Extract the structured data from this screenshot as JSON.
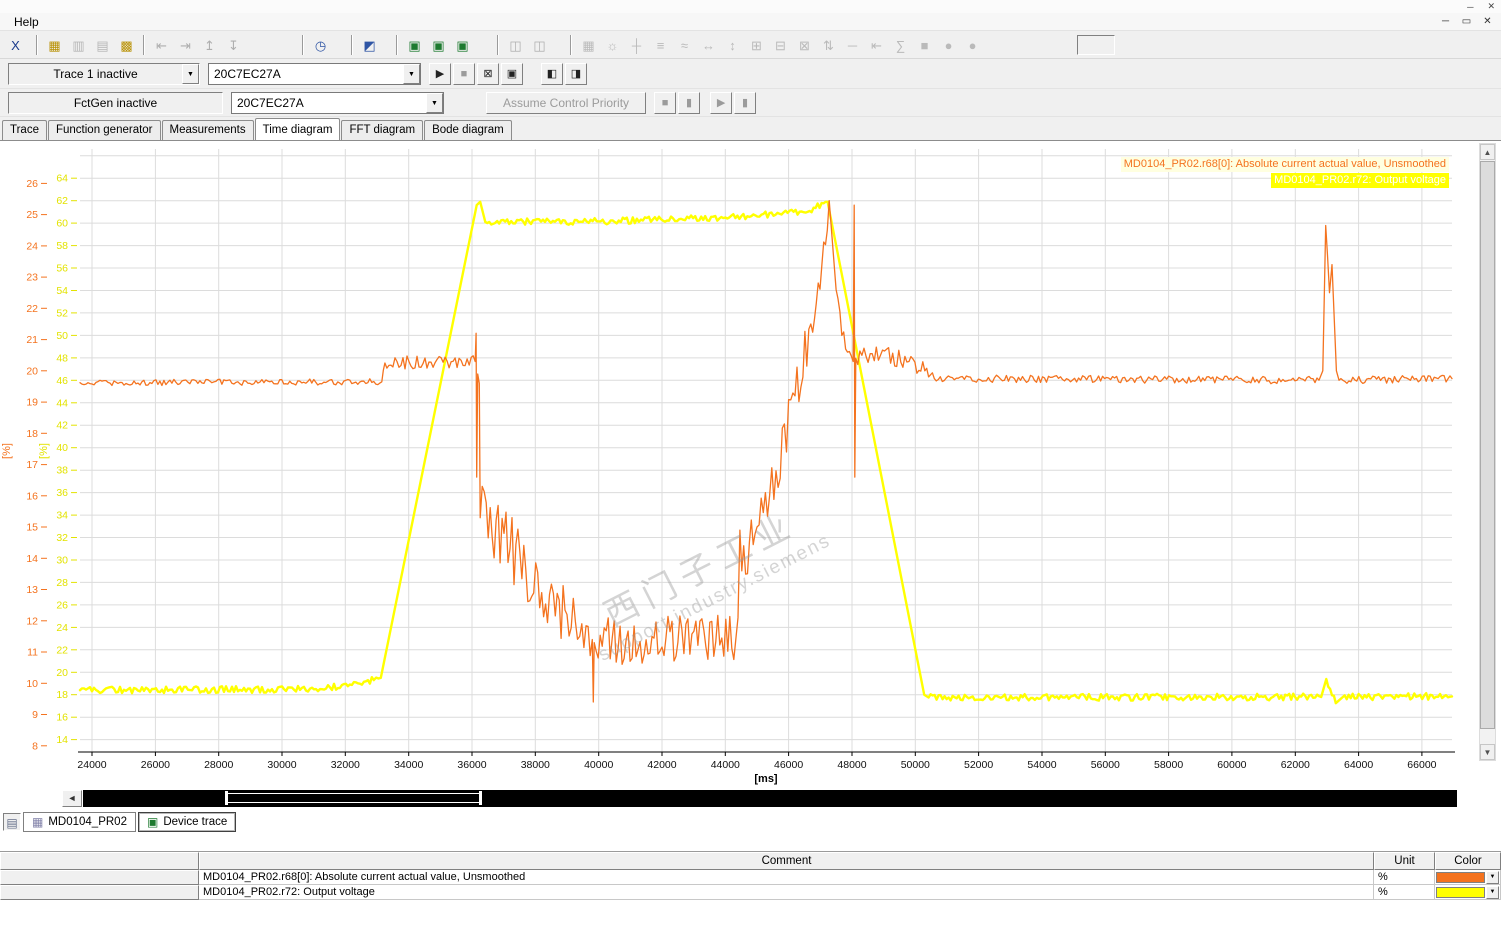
{
  "window": {
    "menu_help": "Help"
  },
  "toolbar": {
    "groups": [
      {
        "icons": [
          {
            "n": "trace-export-icon",
            "g": "X",
            "c": "#1a3a8c",
            "e": true
          }
        ]
      },
      {
        "icons": [
          {
            "n": "show-signal-table-icon",
            "g": "▦",
            "c": "#b89000",
            "e": true
          },
          {
            "n": "copy-diagram-icon",
            "g": "▥",
            "c": "#666666",
            "e": false
          },
          {
            "n": "print-diagram-icon",
            "g": "▤",
            "c": "#666666",
            "e": false
          },
          {
            "n": "signal-grid-icon",
            "g": "▩",
            "c": "#b89000",
            "e": true
          }
        ]
      },
      {
        "icons": [
          {
            "n": "pan-left-icon",
            "g": "⇤",
            "c": "#555555",
            "e": false
          },
          {
            "n": "pan-right-icon",
            "g": "⇥",
            "c": "#555555",
            "e": false
          },
          {
            "n": "dock-up-icon",
            "g": "↥",
            "c": "#555555",
            "e": false
          },
          {
            "n": "dock-down-icon",
            "g": "↧",
            "c": "#555555",
            "e": false
          }
        ]
      },
      {
        "icons": [
          {
            "n": "measurement-clock-icon",
            "g": "◷",
            "c": "#2f55a4",
            "e": true
          }
        ]
      },
      {
        "icons": [
          {
            "n": "control-panel-icon",
            "g": "◩",
            "c": "#2f55a4",
            "e": true
          }
        ]
      },
      {
        "icons": [
          {
            "n": "trace-screen-1-icon",
            "g": "▣",
            "c": "#1d7a2f",
            "e": true
          },
          {
            "n": "trace-screen-2-icon",
            "g": "▣",
            "c": "#1d7a2f",
            "e": true
          },
          {
            "n": "trace-screen-3-icon",
            "g": "▣",
            "c": "#1d7a2f",
            "e": true
          }
        ]
      },
      {
        "icons": [
          {
            "n": "new-window-icon",
            "g": "◫",
            "c": "#555555",
            "e": false
          },
          {
            "n": "split-window-icon",
            "g": "◫",
            "c": "#555555",
            "e": false
          }
        ]
      },
      {
        "icons": [
          {
            "n": "grid-toggle-icon",
            "g": "▦",
            "c": "#707070",
            "e": false
          },
          {
            "n": "settings-icon",
            "g": "☼",
            "c": "#707070",
            "e": false
          },
          {
            "n": "crosshair-cursor-icon",
            "g": "┼",
            "c": "#707070",
            "e": false
          },
          {
            "n": "align-curves-icon",
            "g": "≡",
            "c": "#707070",
            "e": false
          },
          {
            "n": "smooth-curve-icon",
            "g": "≈",
            "c": "#707070",
            "e": false
          },
          {
            "n": "zoom-x-icon",
            "g": "↔",
            "c": "#707070",
            "e": false
          },
          {
            "n": "zoom-y-icon",
            "g": "↕",
            "c": "#707070",
            "e": false
          },
          {
            "n": "zoom-in-icon",
            "g": "⊞",
            "c": "#707070",
            "e": false
          },
          {
            "n": "zoom-out-icon",
            "g": "⊟",
            "c": "#707070",
            "e": false
          },
          {
            "n": "zoom-fit-icon",
            "g": "⊠",
            "c": "#707070",
            "e": false
          },
          {
            "n": "autoscale-icon",
            "g": "⇅",
            "c": "#707070",
            "e": false
          },
          {
            "n": "ruler-icon",
            "g": "─",
            "c": "#707070",
            "e": false
          },
          {
            "n": "cursor-home-icon",
            "g": "⇤",
            "c": "#707070",
            "e": false
          },
          {
            "n": "integral-icon",
            "g": "∑",
            "c": "#707070",
            "e": false
          },
          {
            "n": "stop-shape-icon",
            "g": "■",
            "c": "#707070",
            "e": false
          },
          {
            "n": "record-shape-1-icon",
            "g": "●",
            "c": "#707070",
            "e": false
          },
          {
            "n": "record-shape-2-icon",
            "g": "●",
            "c": "#707070",
            "e": false
          }
        ]
      }
    ]
  },
  "trace_bar": {
    "label": "Trace 1 inactive",
    "device": "20C7EC27A",
    "buttons": [
      {
        "n": "start-trace-icon",
        "g": "▶",
        "e": true
      },
      {
        "n": "stop-trace-icon",
        "g": "■",
        "e": false
      },
      {
        "n": "discard-trace-icon",
        "g": "⊠",
        "e": true
      },
      {
        "n": "save-trace-icon",
        "g": "▣",
        "e": true
      },
      {
        "n": "pane-toggle-1-icon",
        "g": "◧",
        "e": true,
        "gap": 16
      },
      {
        "n": "pane-toggle-2-icon",
        "g": "◨",
        "e": true
      }
    ]
  },
  "fctgen_bar": {
    "label": "FctGen  inactive",
    "device": "20C7EC27A",
    "assume_label": "Assume Control Priority",
    "buttons": [
      {
        "n": "fctgen-mode-1-icon",
        "g": "■",
        "e": false
      },
      {
        "n": "fctgen-mode-2-icon",
        "g": "▮",
        "e": false
      },
      {
        "n": "fctgen-start-icon",
        "g": "▶",
        "e": false,
        "gap": 8
      },
      {
        "n": "fctgen-stop-icon",
        "g": "▮",
        "e": false
      }
    ]
  },
  "tabs": {
    "items": [
      "Trace",
      "Function generator",
      "Measurements",
      "Time diagram",
      "FFT diagram",
      "Bode diagram"
    ],
    "active_index": 3
  },
  "legend": [
    {
      "text": "MD0104_PR02.r68[0]: Absolute current actual value, Unsmoothed",
      "color": "#f4731f",
      "bg": "#ffffe0"
    },
    {
      "text": "MD0104_PR02.r72: Output voltage",
      "color": "#ffffff",
      "bg": "#ffff00"
    }
  ],
  "watermark": {
    "line1": "西门子工业",
    "line2": "support.industry.siemens"
  },
  "chart_data": {
    "type": "line",
    "title": "",
    "xlabel": "[ms]",
    "xlim": [
      23620,
      66950
    ],
    "x_ticks": {
      "start": 24000,
      "end": 66000,
      "step": 2000
    },
    "grid": true,
    "grid_color": "#dcdcdc",
    "legend_position": "top-right",
    "axes": [
      {
        "name": "current-axis",
        "label": "[%]",
        "color": "#f4731f",
        "ylim": [
          7.8,
          27.1
        ],
        "ticks": {
          "start": 26,
          "end": 8,
          "step": -1
        }
      },
      {
        "name": "voltage-axis",
        "label": "[%]",
        "color": "#e3e300",
        "ylim": [
          12.9,
          66.6
        ],
        "ticks": {
          "start": 64,
          "end": 14,
          "step": -2
        }
      }
    ],
    "series": [
      {
        "name": "MD0104_PR02.r72: Output voltage",
        "axis": 1,
        "color": "#ffff00",
        "width": 2.4,
        "points": [
          [
            23620,
            18.4,
            0.3
          ],
          [
            31200,
            18.5,
            0.3
          ],
          [
            32900,
            19.3,
            0.25
          ],
          [
            33120,
            19.5,
            0
          ],
          [
            36150,
            61.6,
            0
          ],
          [
            36260,
            61.9,
            0
          ],
          [
            36420,
            60.1,
            0.3
          ],
          [
            40000,
            60.15,
            0.3
          ],
          [
            44000,
            60.5,
            0.3
          ],
          [
            46600,
            61.0,
            0.3
          ],
          [
            47230,
            61.9,
            0
          ],
          [
            50280,
            18.0,
            0
          ],
          [
            50420,
            17.75,
            0.3
          ],
          [
            62820,
            17.8,
            0
          ],
          [
            62980,
            19.4,
            0.3
          ],
          [
            63280,
            17.25,
            0
          ],
          [
            63500,
            17.8,
            0.3
          ],
          [
            66950,
            17.85,
            0
          ]
        ]
      },
      {
        "name": "MD0104_PR02.r68[0]: Absolute current actual value, Unsmoothed",
        "axis": 0,
        "color": "#f4731f",
        "width": 1.3,
        "points": [
          [
            23620,
            19.62,
            0.1
          ],
          [
            33150,
            19.65,
            0.1
          ],
          [
            33250,
            20.25,
            0.22
          ],
          [
            36100,
            20.3,
            0
          ],
          [
            36130,
            21.2,
            0
          ],
          [
            36150,
            16.6,
            0
          ],
          [
            36180,
            19.9,
            0
          ],
          [
            36230,
            19.6,
            0
          ],
          [
            36260,
            15.3,
            1.1
          ],
          [
            37200,
            14.3,
            1.1
          ],
          [
            38200,
            12.9,
            1.0
          ],
          [
            39000,
            12.2,
            0.9
          ],
          [
            39400,
            11.5,
            0.8
          ],
          [
            39800,
            11.4,
            0
          ],
          [
            39830,
            9.4,
            0
          ],
          [
            39860,
            11.3,
            0.8
          ],
          [
            44330,
            11.4,
            0
          ],
          [
            44400,
            12.1,
            0
          ],
          [
            44460,
            14.9,
            0
          ],
          [
            44520,
            13.6,
            0.8
          ],
          [
            45000,
            15.0,
            0.8
          ],
          [
            45600,
            16.8,
            0.8
          ],
          [
            46200,
            19.2,
            0.8
          ],
          [
            46700,
            21.5,
            0.7
          ],
          [
            47050,
            23.4,
            0.5
          ],
          [
            47280,
            25.45,
            0
          ],
          [
            47500,
            22.6,
            0.35
          ],
          [
            47800,
            20.7,
            0.3
          ],
          [
            48040,
            20.3,
            0
          ],
          [
            48070,
            25.3,
            0
          ],
          [
            48090,
            16.6,
            0
          ],
          [
            48120,
            20.4,
            0.35
          ],
          [
            48900,
            20.5,
            0.3
          ],
          [
            49800,
            20.3,
            0.3
          ],
          [
            50300,
            20.0,
            0.2
          ],
          [
            50600,
            19.75,
            0.12
          ],
          [
            62750,
            19.7,
            0
          ],
          [
            62870,
            20.0,
            0
          ],
          [
            62960,
            24.65,
            0.25
          ],
          [
            63080,
            22.5,
            0
          ],
          [
            63160,
            23.4,
            0
          ],
          [
            63300,
            20.0,
            0
          ],
          [
            63380,
            19.7,
            0.12
          ],
          [
            66950,
            19.75,
            0
          ]
        ]
      }
    ]
  },
  "bottom_tabs": {
    "prefix_icon": {
      "n": "project-list-icon",
      "g": "▤"
    },
    "tabs": [
      {
        "label": "MD0104_PR02",
        "icon": "▦",
        "icon_color": "#8080a8",
        "icon_name": "table-grid-icon",
        "active": false
      },
      {
        "label": "Device trace",
        "icon": "▣",
        "icon_color": "#1d7a2f",
        "icon_name": "device-trace-icon",
        "active": true
      }
    ]
  },
  "signal_table": {
    "headers": [
      "",
      "Comment",
      "Unit",
      "Color"
    ],
    "rows": [
      {
        "comment": "MD0104_PR02.r68[0]: Absolute current actual value, Unsmoothed",
        "unit": "%",
        "color": "#f4731f"
      },
      {
        "comment": "MD0104_PR02.r72: Output voltage",
        "unit": "%",
        "color": "#ffff00"
      }
    ]
  }
}
